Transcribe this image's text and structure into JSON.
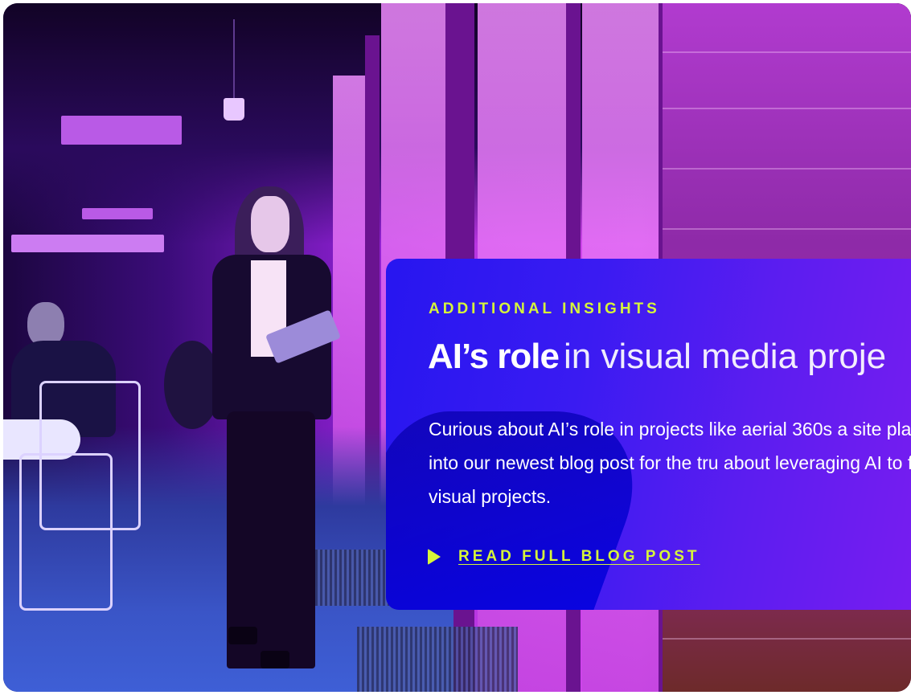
{
  "card": {
    "eyebrow": "ADDITIONAL INSIGHTS",
    "headline_bold": "AI’s role",
    "headline_light": "in visual media proje",
    "body": "Curious about AI’s role in projects like aerial 360s a site plans? Dive into our newest blog post for the tru about leveraging AI to for your visual projects.",
    "cta_label": "READ FULL BLOG POST",
    "cta_icon": "play-triangle-icon"
  },
  "colors": {
    "accent": "#d6f53a",
    "card_gradient_start": "#2716f0",
    "card_gradient_end": "#7a1df0",
    "text": "#ffffff"
  }
}
